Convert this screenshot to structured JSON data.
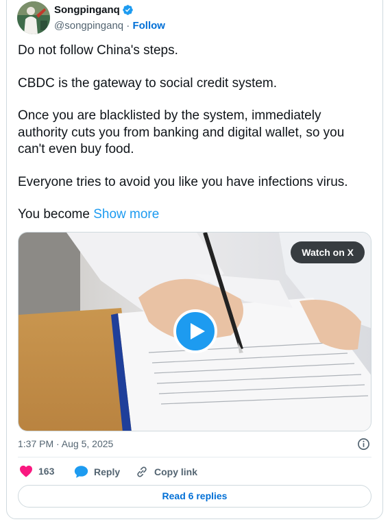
{
  "author": {
    "display_name": "Songpinganq",
    "handle": "@songpinganq",
    "separator": " · ",
    "follow_label": "Follow",
    "verified": true
  },
  "tweet": {
    "paragraphs": [
      "Do not follow China's steps.",
      "CBDC is the gateway to social credit system.",
      "Once you are blacklisted by the system, immediately authority cuts you from banking and digital wallet, so you can't even buy food.",
      "Everyone tries to avoid you like you have infections virus."
    ],
    "truncated_text": "You become ",
    "show_more_label": "Show more"
  },
  "media": {
    "watch_label": "Watch on X",
    "play_icon": "play-icon"
  },
  "meta": {
    "timestamp": "1:37 PM · Aug 5, 2025"
  },
  "actions": {
    "like_count": "163",
    "reply_label": "Reply",
    "copy_link_label": "Copy link"
  },
  "footer": {
    "read_replies_label": "Read 6 replies"
  },
  "colors": {
    "accent": "#1d9bf0",
    "link": "#006fd6",
    "like": "#f91880",
    "muted": "#536471"
  }
}
